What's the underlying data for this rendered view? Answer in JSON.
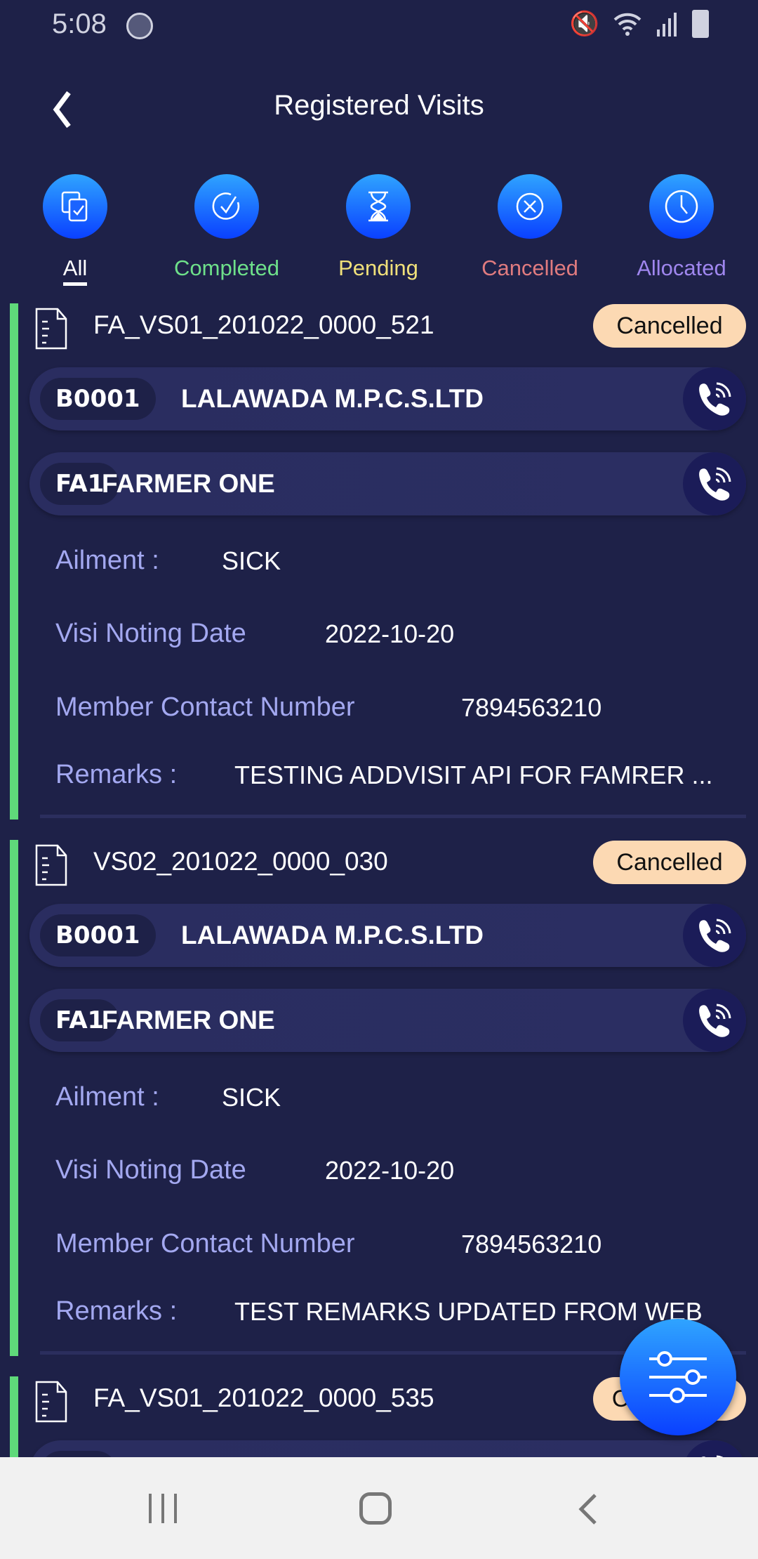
{
  "status_bar": {
    "time": "5:08"
  },
  "header": {
    "title": "Registered Visits"
  },
  "filters": [
    {
      "label": "All",
      "color": "#ffffff",
      "icon": "documents-check-icon",
      "active": true
    },
    {
      "label": "Completed",
      "color": "#6ee08a",
      "icon": "check-circle-icon"
    },
    {
      "label": "Pending",
      "color": "#f0e07a",
      "icon": "hourglass-icon"
    },
    {
      "label": "Cancelled",
      "color": "#e07b7f",
      "icon": "x-circle-icon"
    },
    {
      "label": "Allocated",
      "color": "#9f86ee",
      "icon": "clock-icon"
    }
  ],
  "field_labels": {
    "ailment": "Ailment :",
    "date": "Visi Noting Date",
    "contact": "Member Contact Number",
    "remarks": "Remarks :"
  },
  "visits": [
    {
      "id": "FA_VS01_201022_0000_521",
      "status": "Cancelled",
      "society_code": "B0001",
      "society_name": "LALAWADA M.P.C.S.LTD",
      "farmer_code": "FA1",
      "farmer_name": "FARMER ONE",
      "ailment": "SICK",
      "date": "2022-10-20",
      "contact": "7894563210",
      "remarks": "TESTING ADDVISIT API FOR FAMRER ..."
    },
    {
      "id": "VS02_201022_0000_030",
      "status": "Cancelled",
      "society_code": "B0001",
      "society_name": "LALAWADA M.P.C.S.LTD",
      "farmer_code": "FA1",
      "farmer_name": "FARMER ONE",
      "ailment": "SICK",
      "date": "2022-10-20",
      "contact": "7894563210",
      "remarks": "TEST REMARKS UPDATED FROM WEB"
    },
    {
      "id": "FA_VS01_201022_0000_535",
      "status": "Completed"
    }
  ],
  "colors": {
    "background": "#1e2148",
    "accent": "#0a40ff",
    "card_bar": "#5fd97a",
    "badge": "#fcd9b3",
    "label": "#a3a8f0"
  }
}
